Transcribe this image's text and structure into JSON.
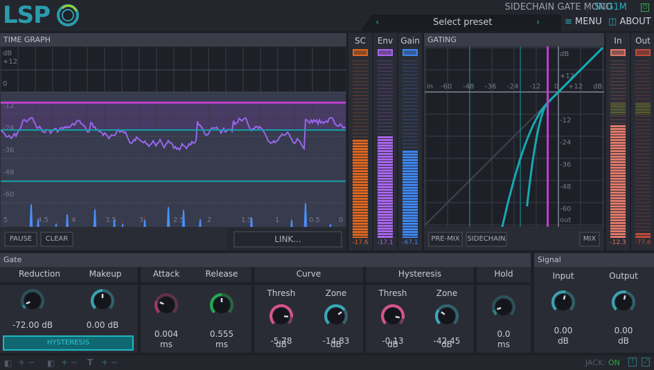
{
  "header": {
    "logo": "LSP",
    "plugin_title": "SIDECHAIN GATE MONO",
    "plugin_code": "SCG1M",
    "preset_label": "Select preset",
    "prev": "‹",
    "next": "›",
    "menu": "MENU",
    "about": "ABOUT",
    "power_icon": "power-icon"
  },
  "time_graph": {
    "title": "TIME GRAPH",
    "y_labels": [
      "dB",
      "+12",
      "0",
      "-12",
      "-24",
      "-36",
      "-48",
      "-60"
    ],
    "x_labels": [
      "5",
      "4.5",
      "4",
      "3.5",
      "3",
      "2.5",
      "2",
      "1.5",
      "1",
      "0.5",
      "0"
    ],
    "pause": "PAUSE",
    "clear": "CLEAR",
    "link": "LINK...",
    "threshold_db": -5.78,
    "zone_db": -20.61,
    "hysteresis_db": -48.4
  },
  "meters": {
    "sc": {
      "label": "SC",
      "value": "-17.6",
      "level": 0.55,
      "color": "#e0661e"
    },
    "env": {
      "label": "Env",
      "value": "-17.1",
      "level": 0.57,
      "color": "#a866ee"
    },
    "gain": {
      "label": "Gain",
      "value": "-67.1",
      "level": 0.49,
      "color": "#3d86f0"
    },
    "in": {
      "label": "In",
      "value": "-12.3",
      "level": 0.63,
      "color": "#e0786a"
    },
    "out": {
      "label": "Out",
      "value": "-77.6",
      "level": 0.03,
      "color": "#c04a3a"
    }
  },
  "gating": {
    "title": "GATING",
    "in_labels": [
      "in",
      "-60",
      "-48",
      "-36",
      "-24",
      "-12",
      "0",
      "+12",
      "dB"
    ],
    "out_labels": [
      "dB",
      "+12",
      "-12",
      "-24",
      "-36",
      "-48",
      "-60",
      "out"
    ],
    "pre_mix": "PRE-MIX",
    "sidechain": "SIDECHAIN",
    "mix": "MIX"
  },
  "gate": {
    "title": "Gate",
    "groups": {
      "reduction": "Reduction",
      "makeup": "Makeup",
      "attack": "Attack",
      "release": "Release",
      "curve": "Curve",
      "hysteresis": "Hysteresis",
      "hold": "Hold"
    },
    "hysteresis_button": "HYSTERESIS",
    "knobs": [
      {
        "id": "reduction",
        "value": "-72.00 dB",
        "unit": "",
        "level": 0.08,
        "color": "#2e7f8a"
      },
      {
        "id": "makeup",
        "value": "0.00 dB",
        "unit": "",
        "level": 0.5,
        "color": "#3aa2b0"
      },
      {
        "id": "attack",
        "value": "0.004",
        "unit": "ms",
        "level": 0.25,
        "color": "#a33a62"
      },
      {
        "id": "release",
        "value": "0.555",
        "unit": "ms",
        "level": 0.5,
        "color": "#1fae4e"
      },
      {
        "id": "curve-thresh",
        "label": "Thresh",
        "value": "-5.78",
        "unit": "dB",
        "level": 0.85,
        "color": "#d8548a"
      },
      {
        "id": "curve-zone",
        "label": "Zone",
        "value": "-14.83",
        "unit": "dB",
        "level": 0.7,
        "color": "#3aa9b8"
      },
      {
        "id": "hyst-thresh",
        "label": "Thresh",
        "value": "-0.13",
        "unit": "dB",
        "level": 0.88,
        "color": "#d8548a"
      },
      {
        "id": "hyst-zone",
        "label": "Zone",
        "value": "-42.45",
        "unit": "dB",
        "level": 0.3,
        "color": "#3aa9b8"
      },
      {
        "id": "hold",
        "value": "0.0",
        "unit": "ms",
        "level": 0.1,
        "color": "#2e7f8a"
      }
    ]
  },
  "signal": {
    "title": "Signal",
    "input": "Input",
    "output": "Output",
    "knobs": [
      {
        "id": "input",
        "value": "0.00",
        "unit": "dB",
        "level": 0.55,
        "color": "#3aa2b0"
      },
      {
        "id": "output",
        "value": "0.00",
        "unit": "dB",
        "level": 0.55,
        "color": "#3aa2b0"
      }
    ]
  },
  "footer": {
    "jack_label": "JACK:",
    "jack_status": "ON",
    "help": "?",
    "plus": "+",
    "minus": "−"
  }
}
